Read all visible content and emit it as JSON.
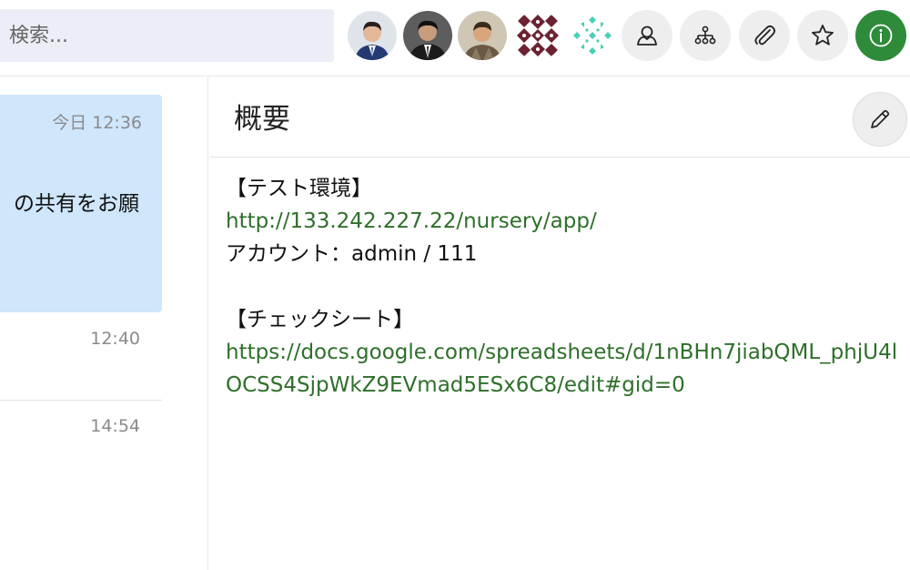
{
  "search": {
    "placeholder": "検索..."
  },
  "toolbar": {
    "avatars": [
      "member-avatar-1",
      "member-avatar-2",
      "member-avatar-3",
      "member-avatar-4",
      "member-avatar-5"
    ],
    "buttons": [
      "contacts-icon",
      "org-chart-icon",
      "paperclip-icon",
      "star-icon",
      "info-icon"
    ],
    "accent": "#2e8b3a"
  },
  "messages": {
    "first": {
      "time": "今日 12:36",
      "text": "の共有をお願",
      "bg": "#cfe6fb"
    },
    "second": {
      "time": "12:40"
    },
    "third": {
      "time": "14:54"
    }
  },
  "summary": {
    "title": "概要",
    "lines": {
      "l1": "【テスト環境】",
      "l2": "http://133.242.227.22/nursery/app/",
      "l3": "アカウント：admin / 111",
      "l4": "",
      "l5": "【チェックシート】",
      "l6": "https://docs.google.com/spreadsheets/d/1nBHn7jiabQML_phjU4l",
      "l7": "OCSS4SjpWkZ9EVmad5ESx6C8/edit#gid=0"
    },
    "link_color": "#2e6f2a"
  }
}
